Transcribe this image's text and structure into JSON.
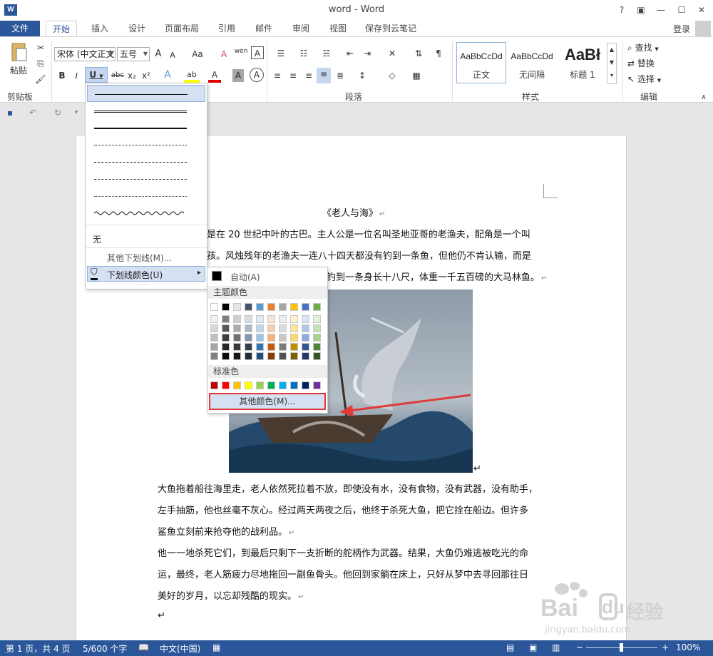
{
  "window": {
    "title": "word - Word",
    "help": "?",
    "restore_ribbon": "▣",
    "minimize": "—",
    "maximize": "☐",
    "close": "✕",
    "app_icon": "W"
  },
  "tabs": [
    "文件",
    "开始",
    "插入",
    "设计",
    "页面布局",
    "引用",
    "邮件",
    "审阅",
    "视图",
    "保存到云笔记"
  ],
  "account": {
    "login": "登录"
  },
  "ribbon": {
    "clipboard": {
      "label": "剪贴板",
      "paste": "粘贴"
    },
    "font": {
      "name": "宋体 (中文正文)",
      "size": "五号",
      "label": "字体",
      "bold": "B",
      "italic": "I",
      "underline": "U",
      "strike": "abc",
      "sub": "x₂",
      "sup": "x²",
      "grow": "A",
      "shrink": "A",
      "case": "Aa",
      "clear": "A",
      "pinyin": "wén",
      "border": "A",
      "effects": "A",
      "highlight": "ab",
      "color": "A",
      "shading": "A",
      "circle": "A"
    },
    "paragraph": {
      "label": "段落"
    },
    "styles": {
      "label": "样式",
      "items": [
        {
          "sample": "AaBbCcDd",
          "name": "正文"
        },
        {
          "sample": "AaBbCcDd",
          "name": "无间隔"
        },
        {
          "sample": "AaBł",
          "name": "标题 1"
        }
      ]
    },
    "editing": {
      "label": "编辑",
      "find": "查找",
      "replace": "替换",
      "select": "选择"
    }
  },
  "document": {
    "title": "《老人与海》",
    "lines": [
      "是在 20 世纪中叶的古巴。主人公是一位名叫圣地亚哥的老渔夫，配角是一个叫",
      "孩。风烛残年的老渔夫一连八十四天都没有钓到一条鱼，但他仍不肯认输，而是",
      "钓到一条身长十八尺，体重一千五百磅的大马林鱼。"
    ],
    "paragraphs": [
      "大鱼拖着船往海里走，老人依然死拉着不放，即使没有水，没有食物，没有武器，没有助手，",
      "左手抽筋，他也丝毫不灰心。经过两天两夜之后，他终于杀死大鱼，把它拴在船边。但许多",
      "鲨鱼立刻前来抢夺他的战利品。",
      "他一一地杀死它们，到最后只剩下一支折断的舵柄作为武器。结果，大鱼仍难逃被吃光的命",
      "运，最终，老人筋疲力尽地拖回一副鱼骨头。他回到家躺在床上，只好从梦中去寻回那往日",
      "美好的岁月，以忘却残酷的现实。"
    ],
    "para_mark": "↵"
  },
  "underline_menu": {
    "none": "无",
    "more_underlines": "其他下划线(M)...",
    "underline_color": "下划线颜色(U)",
    "arrow": "▸",
    "grip": "⋯⋯"
  },
  "color_menu": {
    "auto": "自动(A)",
    "theme_header": "主题颜色",
    "standard_header": "标准色",
    "more_colors": "其他颜色(M)...",
    "theme_top": [
      "#ffffff",
      "#000000",
      "#e7e6e6",
      "#44546a",
      "#5b9bd5",
      "#ed7d31",
      "#a5a5a5",
      "#ffc000",
      "#4472c4",
      "#70ad47"
    ],
    "theme_shades": [
      [
        "#f2f2f2",
        "#7f7f7f",
        "#d0cece",
        "#d6dce4",
        "#deebf6",
        "#fbe5d5",
        "#ededed",
        "#fff2cc",
        "#dae3f3",
        "#e2efd9"
      ],
      [
        "#d8d8d8",
        "#595959",
        "#aeabab",
        "#adb9ca",
        "#bdd7ee",
        "#f7cbac",
        "#dbdbdb",
        "#fee599",
        "#b4c6e7",
        "#c5e0b3"
      ],
      [
        "#bfbfbf",
        "#3f3f3f",
        "#757070",
        "#8496b0",
        "#9dc3e6",
        "#f4b183",
        "#c9c9c9",
        "#ffd965",
        "#8eaadb",
        "#a8d08d"
      ],
      [
        "#a5a5a5",
        "#262626",
        "#3a3838",
        "#323f4f",
        "#2e75b5",
        "#c55a11",
        "#7b7b7b",
        "#bf9000",
        "#2f5496",
        "#538135"
      ],
      [
        "#7f7f7f",
        "#0c0c0c",
        "#171616",
        "#222a35",
        "#1e4e79",
        "#833c0b",
        "#525252",
        "#7f6000",
        "#1f3864",
        "#375623"
      ]
    ],
    "standard": [
      "#c00000",
      "#ff0000",
      "#ffc000",
      "#ffff00",
      "#92d050",
      "#00b050",
      "#00b0f0",
      "#0070c0",
      "#002060",
      "#7030a0"
    ]
  },
  "status": {
    "page": "第 1 页，共 4 页",
    "words": "5/600 个字",
    "lang": "中文(中国)",
    "zoom_minus": "−",
    "zoom_plus": "+",
    "zoom": "100%"
  },
  "watermark": {
    "brand": "Bai",
    "brand2": "经验",
    "url": "jingyan.baidu.com"
  },
  "colors": {
    "accent": "#2b579a",
    "highlight": "#d5e1f2",
    "callout": "#e03a3a"
  }
}
